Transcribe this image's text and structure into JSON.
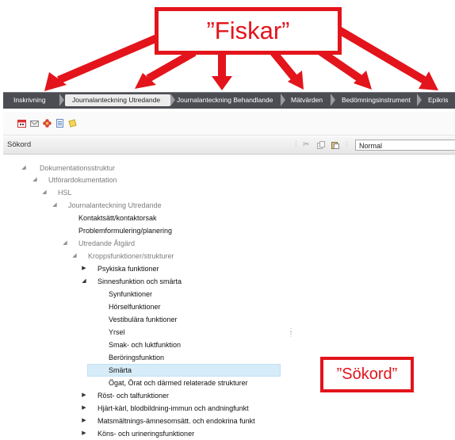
{
  "annotations": {
    "top_label": "”Fiskar”",
    "side_label": "”Sökord”",
    "color": "#e3141b"
  },
  "breadcrumb": {
    "items": [
      {
        "label": "Inskrivning",
        "active": false
      },
      {
        "label": "Journalanteckning Utredande",
        "active": true
      },
      {
        "label": "Journalanteckning Behandlande",
        "active": false
      },
      {
        "label": "Mätvärden",
        "active": false
      },
      {
        "label": "Bedömningsinstrument",
        "active": false
      },
      {
        "label": "Epikris",
        "active": false
      }
    ]
  },
  "toolbar": {
    "icons": [
      "calendar-icon",
      "mail-icon",
      "flower-icon",
      "document-icon",
      "note-icon"
    ]
  },
  "left_pane": {
    "title": "Sökord"
  },
  "right_pane": {
    "icons": [
      "cut-icon",
      "copy-icon",
      "paste-icon"
    ],
    "style_value": "Normal"
  },
  "tree": [
    {
      "label": "Dokumentationsstruktur",
      "expanded": true
    },
    {
      "label": "Utförardokumentation",
      "expanded": true
    },
    {
      "label": "HSL",
      "expanded": true
    },
    {
      "label": "Journalanteckning Utredande",
      "expanded": true
    },
    {
      "label": "Kontaktsätt/kontaktorsak"
    },
    {
      "label": "Problemformulering/planering"
    },
    {
      "label": "Utredande Åtgärd",
      "expanded": true
    },
    {
      "label": "Kroppsfunktioner/strukturer",
      "expanded": true
    },
    {
      "label": "Psykiska funktioner",
      "expanded": false
    },
    {
      "label": "Sinnesfunktion och smärta",
      "expanded": true
    },
    {
      "label": "Synfunktioner"
    },
    {
      "label": "Hörselfunktioner"
    },
    {
      "label": "Vestibulära funktioner"
    },
    {
      "label": "Yrsel"
    },
    {
      "label": "Smak- och luktfunktion"
    },
    {
      "label": "Beröringsfunktion"
    },
    {
      "label": "Smärta",
      "selected": true
    },
    {
      "label": "Ögat, Örat och därmed relaterade strukturer"
    },
    {
      "label": "Röst- och talfunktioner",
      "expanded": false
    },
    {
      "label": "Hjärt-kärl, blodbildning-immun och andningfunkt",
      "expanded": false
    },
    {
      "label": "Matsmältnings-ämnesomsätt. och endokrina funkt",
      "expanded": false
    },
    {
      "label": "Köns- och urineringsfunktioner",
      "expanded": false
    }
  ]
}
